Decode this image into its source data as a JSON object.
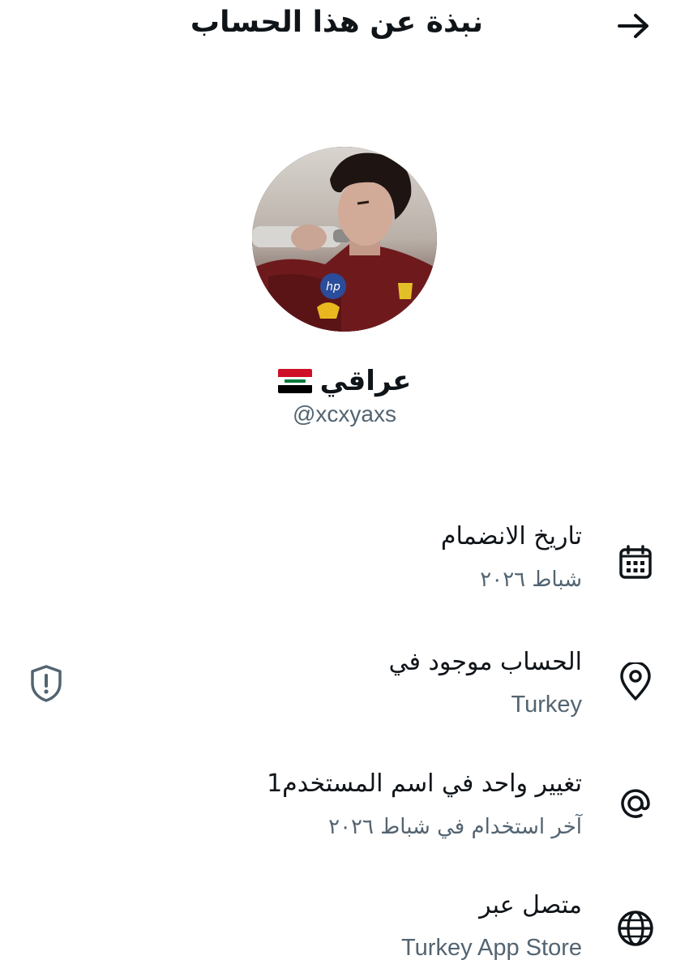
{
  "header": {
    "title": "نبذة عن هذا الحساب",
    "back_icon": "arrow-right-icon"
  },
  "profile": {
    "display_name": "عراقي",
    "flag_icon": "iraq-flag-icon",
    "handle": "@xcxyaxs"
  },
  "info": [
    {
      "icon": "calendar-icon",
      "title": "تاريخ الانضمام",
      "subtitle": "شباط ٢٠٢٦"
    },
    {
      "icon": "location-pin-icon",
      "title": "الحساب موجود في",
      "subtitle": "Turkey",
      "side_icon": "shield-alert-icon"
    },
    {
      "icon": "at-sign-icon",
      "title": "تغيير واحد في اسم المستخدم1",
      "subtitle": "آخر استخدام في شباط ٢٠٢٦"
    },
    {
      "icon": "globe-icon",
      "title": "متصل عبر",
      "subtitle": "Turkey App Store"
    }
  ],
  "colors": {
    "text_primary": "#0f1419",
    "text_secondary": "#536471",
    "background": "#ffffff"
  }
}
